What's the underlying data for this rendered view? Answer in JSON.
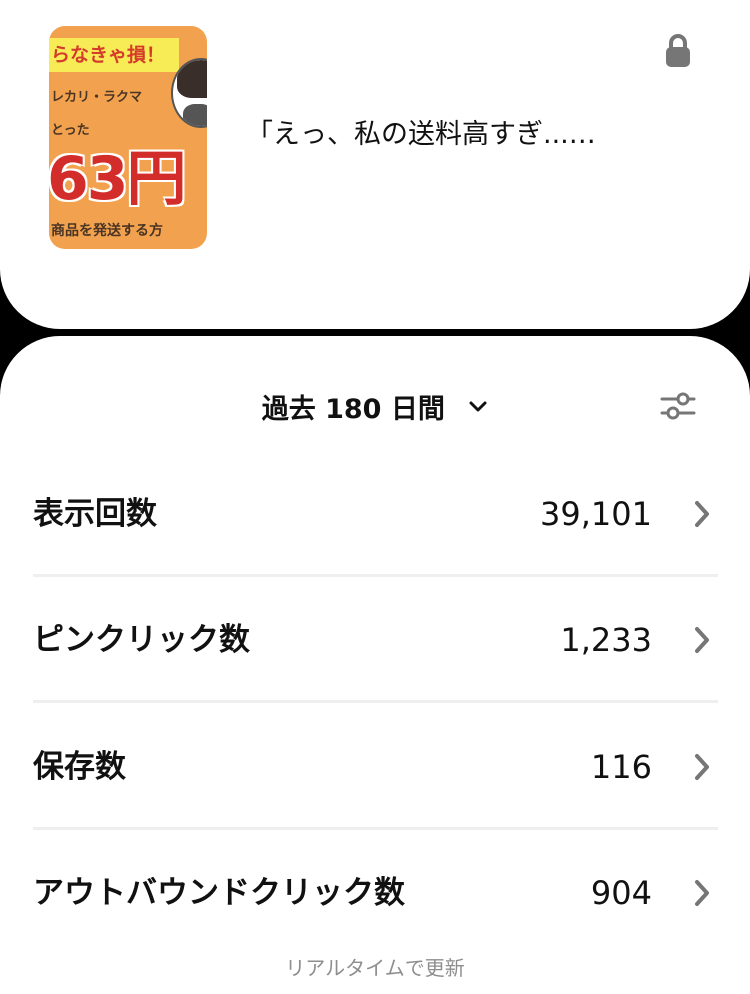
{
  "pin": {
    "title": "「えっ、私の送料高すぎ...…",
    "thumbnail": {
      "line1": "らなきゃ損！",
      "line2": "レカリ・ラクマ",
      "line3": "とった",
      "big_text": "63円",
      "line4": "商品を発送する方"
    },
    "lock_icon": "lock-icon"
  },
  "stats": {
    "period_label": "過去 180 日間",
    "filter_icon": "sliders-icon",
    "metrics": [
      {
        "label": "表示回数",
        "value": "39,101"
      },
      {
        "label": "ピンクリック数",
        "value": "1,233"
      },
      {
        "label": "保存数",
        "value": "116"
      },
      {
        "label": "アウトバウンドクリック数",
        "value": "904"
      }
    ],
    "footer_note": "リアルタイムで更新"
  },
  "colors": {
    "background": "#000000",
    "card": "#ffffff",
    "text": "#111111",
    "muted": "#8e8e8e",
    "icon": "#767676",
    "divider": "#efefef"
  }
}
